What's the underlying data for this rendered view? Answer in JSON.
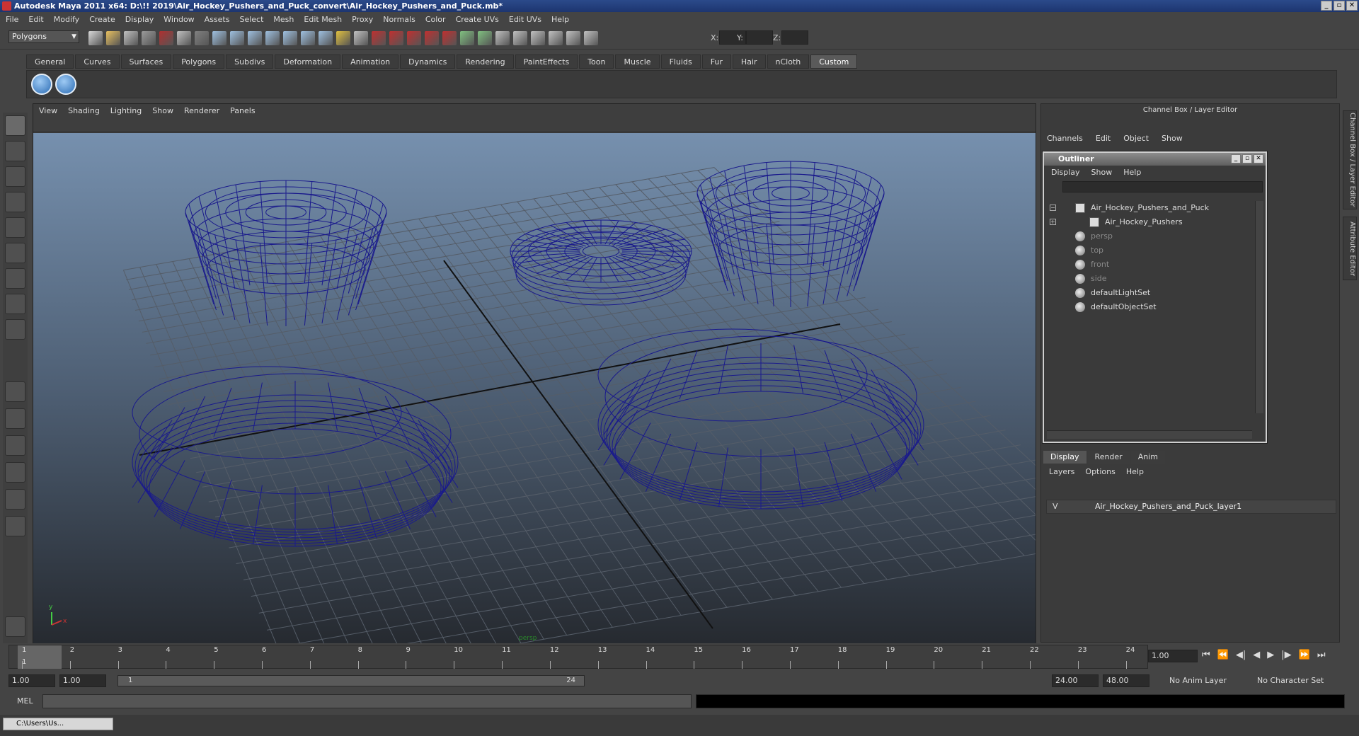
{
  "window": {
    "title": "Autodesk Maya 2011 x64: D:\\!! 2019\\Air_Hockey_Pushers_and_Puck_convert\\Air_Hockey_Pushers_and_Puck.mb*",
    "buttons": [
      "_",
      "▫",
      "✕"
    ]
  },
  "menubar": [
    "File",
    "Edit",
    "Modify",
    "Create",
    "Display",
    "Window",
    "Assets",
    "Select",
    "Mesh",
    "Edit Mesh",
    "Proxy",
    "Normals",
    "Color",
    "Create UVs",
    "Edit UVs",
    "Help"
  ],
  "status_line": {
    "mode": "Polygons",
    "coord_labels": [
      "X:",
      "Y:",
      "Z:"
    ]
  },
  "shelf": {
    "tabs": [
      "General",
      "Curves",
      "Surfaces",
      "Polygons",
      "Subdivs",
      "Deformation",
      "Animation",
      "Dynamics",
      "Rendering",
      "PaintEffects",
      "Toon",
      "Muscle",
      "Fluids",
      "Fur",
      "Hair",
      "nCloth",
      "Custom"
    ],
    "active_tab": "Custom"
  },
  "viewport": {
    "menu": [
      "View",
      "Shading",
      "Lighting",
      "Show",
      "Renderer",
      "Panels"
    ],
    "camera_label": "persp",
    "wire_color": "#1a1a8c"
  },
  "channel_box": {
    "title": "Channel Box / Layer Editor",
    "menu": [
      "Channels",
      "Edit",
      "Object",
      "Show"
    ]
  },
  "outliner": {
    "title": "Outliner",
    "menu": [
      "Display",
      "Show",
      "Help"
    ],
    "items": [
      {
        "label": "Air_Hockey_Pushers_and_Puck",
        "expander": "−",
        "indent": 0,
        "dim": false,
        "icon": "mesh-icon"
      },
      {
        "label": "Air_Hockey_Pushers",
        "expander": "+",
        "indent": 1,
        "dim": false,
        "icon": "mesh-icon"
      },
      {
        "label": "persp",
        "expander": "",
        "indent": 0,
        "dim": true,
        "icon": "camera-icon"
      },
      {
        "label": "top",
        "expander": "",
        "indent": 0,
        "dim": true,
        "icon": "camera-icon"
      },
      {
        "label": "front",
        "expander": "",
        "indent": 0,
        "dim": true,
        "icon": "camera-icon"
      },
      {
        "label": "side",
        "expander": "",
        "indent": 0,
        "dim": true,
        "icon": "camera-icon"
      },
      {
        "label": "defaultLightSet",
        "expander": "",
        "indent": 0,
        "dim": false,
        "icon": "set-icon"
      },
      {
        "label": "defaultObjectSet",
        "expander": "",
        "indent": 0,
        "dim": false,
        "icon": "set-icon"
      }
    ]
  },
  "layer_editor": {
    "tabs": [
      "Display",
      "Render",
      "Anim"
    ],
    "active_tab": "Display",
    "menu": [
      "Layers",
      "Options",
      "Help"
    ],
    "layer": {
      "visible": "V",
      "name": "Air_Hockey_Pushers_and_Puck_layer1"
    }
  },
  "side_tabs": [
    "Channel Box / Layer Editor",
    "Attribute Editor"
  ],
  "timeline": {
    "frames": [
      1,
      2,
      3,
      4,
      5,
      6,
      7,
      8,
      9,
      10,
      11,
      12,
      13,
      14,
      15,
      16,
      17,
      18,
      19,
      20,
      21,
      22,
      23,
      24
    ],
    "current_frame": "1",
    "current_frame_field": "1.00"
  },
  "range": {
    "start": "1.00",
    "anim_start": "1.00",
    "slider_start": "1",
    "slider_end": "24",
    "anim_end": "24.00",
    "end": "48.00",
    "anim_layer": "No Anim Layer",
    "character_set": "No Character Set"
  },
  "command_line": {
    "label": "MEL"
  },
  "taskbar": {
    "item": "C:\\Users\\Us..."
  }
}
